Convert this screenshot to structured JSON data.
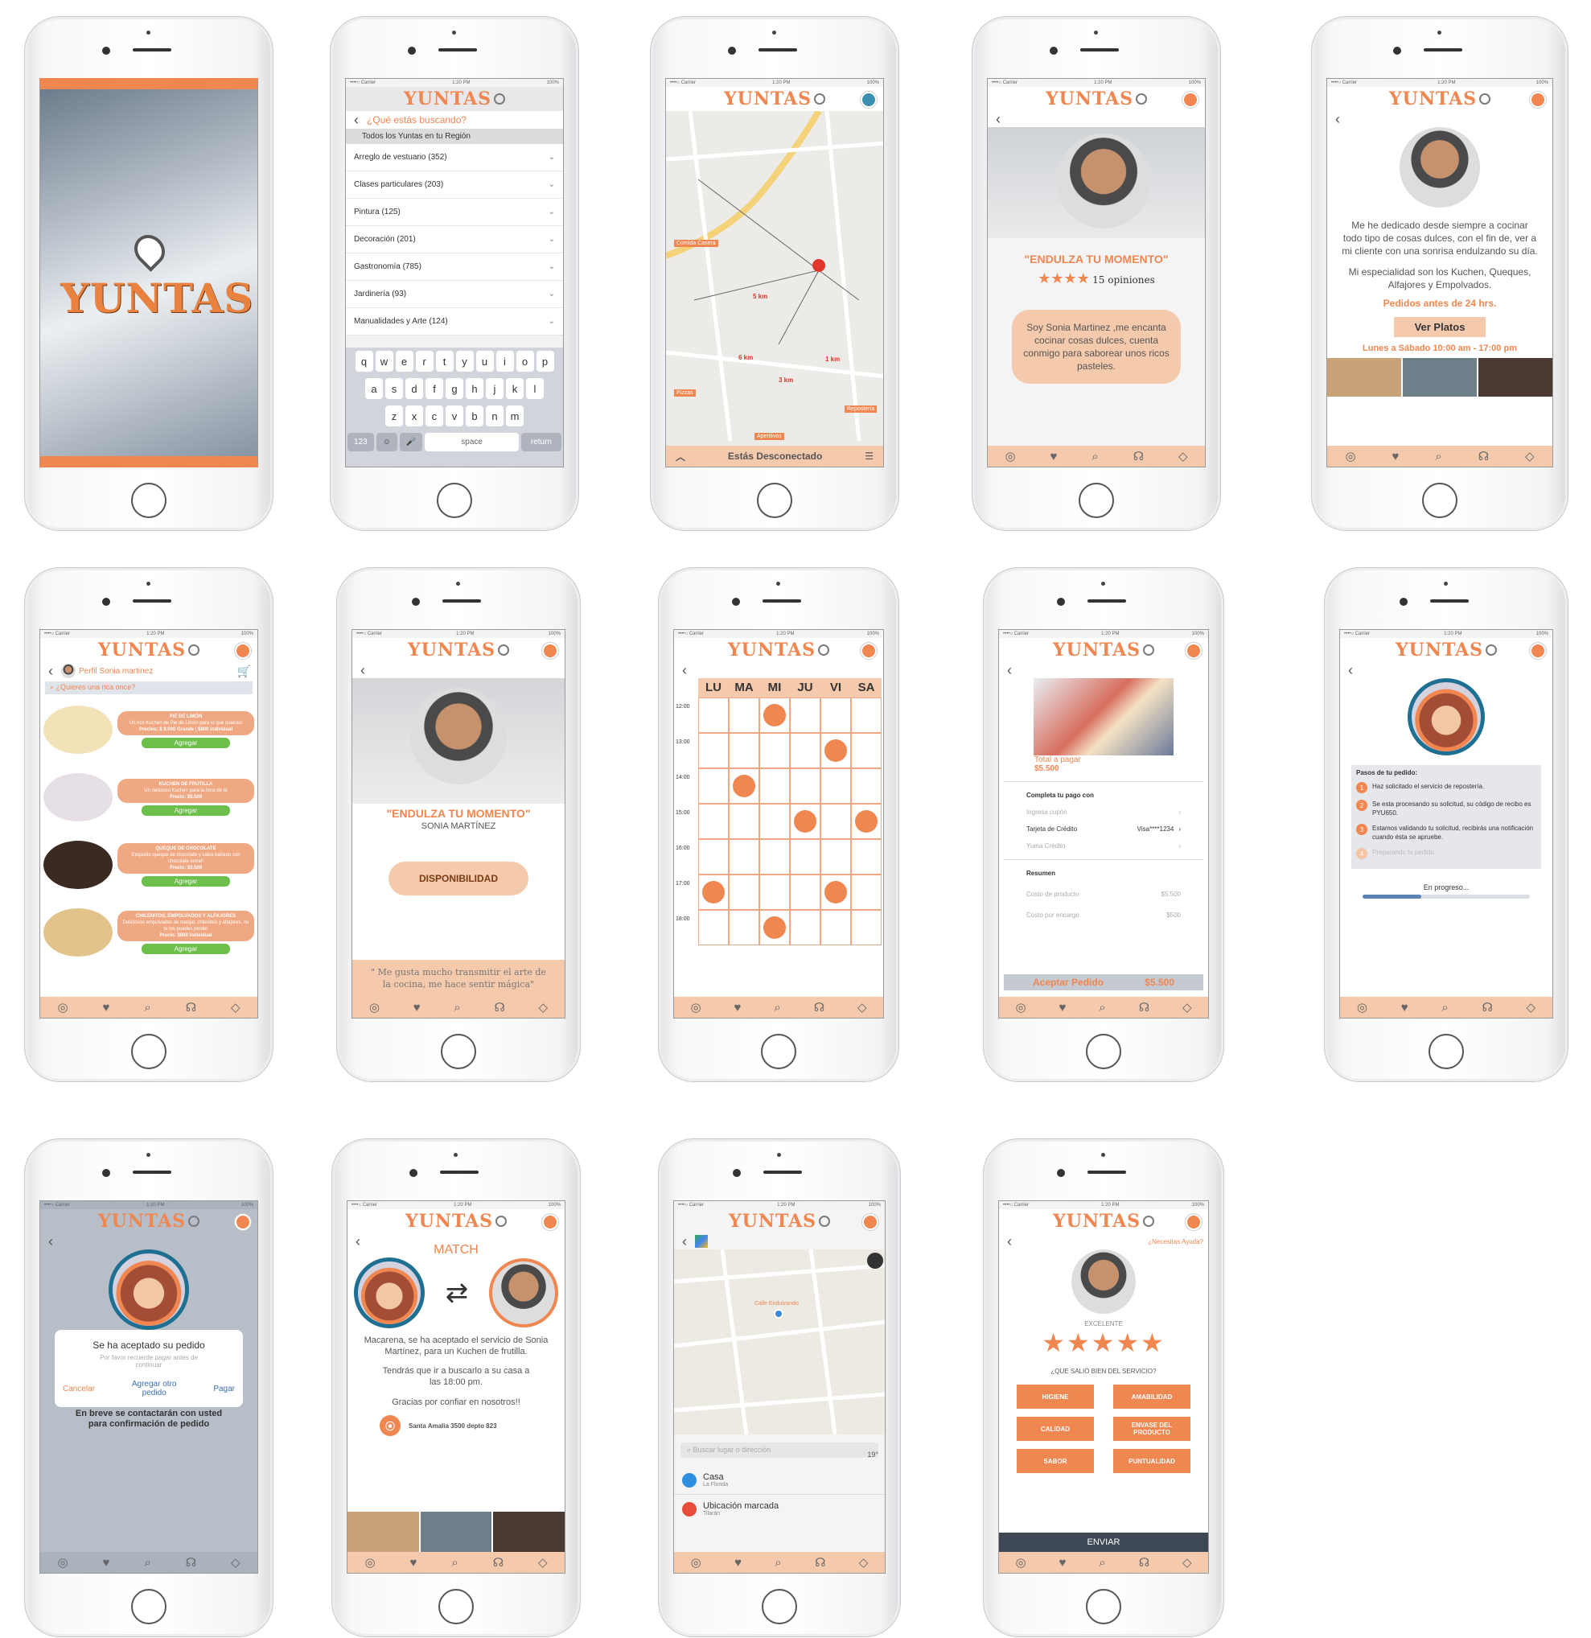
{
  "brand": {
    "name": "YUNTAS"
  },
  "status": {
    "carrier": "••••○ Carrier",
    "time": "1:20 PM",
    "battery": "100%"
  },
  "p1": {
    "logo": "YUNTAS"
  },
  "p2": {
    "prompt": "¿Qué estás buscando?",
    "region": "Todos los Yuntas en tu Región",
    "items": [
      "Arreglo de vestuario (352)",
      "Clases particulares (203)",
      "Pintura (125)",
      "Decoración (201)",
      "Gastronomía (785)",
      "Jardinería (93)",
      "Manualidades y Arte (124)"
    ],
    "keys": {
      "row1": [
        "q",
        "w",
        "e",
        "r",
        "t",
        "y",
        "u",
        "i",
        "o",
        "p"
      ],
      "row2": [
        "a",
        "s",
        "d",
        "f",
        "g",
        "h",
        "j",
        "k",
        "l"
      ],
      "row3": [
        "z",
        "x",
        "c",
        "v",
        "b",
        "n",
        "m"
      ],
      "k123": "123",
      "space": "space",
      "ret": "return"
    }
  },
  "p3": {
    "labels": [
      "Comida Casera",
      "Pizzas",
      "Aperitivos",
      "Repostería"
    ],
    "distances": [
      "5 km",
      "6 km",
      "3 km",
      "1 km"
    ],
    "footer": "Estás Desconectado"
  },
  "p4": {
    "title": "\"ENDULZA TU MOMENTO\"",
    "reviews": "15 opiniones",
    "stars": "★★★★",
    "bio": "Soy Sonia Martinez ,me encanta cocinar cosas dulces, cuenta conmigo para saborear unos ricos pasteles."
  },
  "p5": {
    "text1": "Me he dedicado desde siempre a cocinar todo tipo de cosas dulces, con el fin de, ver a mi cliente con una sonrisa endulzando su día.",
    "text2": "Mi especialidad son los Kuchen, Queques, Alfajores y Empolvados.",
    "orders": "Pedidos antes de 24 hrs.",
    "button": "Ver Platos",
    "hours": "Lunes a Sábado 10:00 am - 17:00 pm"
  },
  "p6": {
    "profile": "Perfil Sonia martinez",
    "search": "¿Quieres una rica once?",
    "products": [
      {
        "name": "PIE DE LIMÓN",
        "desc": "Un rico Kuchen de Pie de Limón para lo que quieras!",
        "price": "Precios: $ 9.000 Grande | $800 individual",
        "add": "Agregar"
      },
      {
        "name": "KUCHEN DE FRUTILLA",
        "desc": "Un delicioso Kuchen para la hora de té",
        "price": "Precio: $5.500",
        "add": "Agregar"
      },
      {
        "name": "QUEQUE DE CHOCOLATE",
        "desc": "Exquisito queque de chocolate y salsa bañado con chocolate extra!!",
        "price": "Precio: $3.500",
        "add": "Agregar"
      },
      {
        "name": "CHILENITOS, EMPOLVADOS Y ALFAJORES",
        "desc": "Deliciosos empolvados de manjar, chilenitos y alfajores, no te los puedes perder",
        "price": "Precio: $800 individual",
        "add": "Agregar"
      }
    ]
  },
  "p7": {
    "title": "\"ENDULZA TU MOMENTO\"",
    "name": "SONIA MARTÍNEZ",
    "button": "DISPONIBILIDAD",
    "quote": "\" Me gusta mucho transmitir el arte de la cocina, me hace sentir mágica\""
  },
  "p8": {
    "days": [
      "LU",
      "MA",
      "MI",
      "JU",
      "VI",
      "SA"
    ],
    "hours": [
      "12:00",
      "13:00",
      "14:00",
      "15:00",
      "16:00",
      "17:00",
      "18:00"
    ],
    "slots": [
      [
        0,
        2
      ],
      [
        1,
        4
      ],
      [
        2,
        1
      ],
      [
        3,
        3
      ],
      [
        3,
        5
      ],
      [
        5,
        0
      ],
      [
        5,
        4
      ],
      [
        6,
        2
      ]
    ]
  },
  "p9": {
    "total_label": "Total a pagar",
    "total": "$5.500",
    "complete": "Completa tu pago con",
    "opt1": "Ingresa cupón",
    "opt2": "Tarjeta de Crédito",
    "opt2val": "Visa****1234",
    "opt3": "Yuma Crédito",
    "summary": "Resumen",
    "row1": "Costo de producto",
    "row1v": "$5.500",
    "row2": "Costo por encargo",
    "row2v": "$500",
    "accept": "Aceptar Pedido",
    "accept_val": "$5.500"
  },
  "p10": {
    "title": "Pasos de tu pedido:",
    "steps": [
      "Haz solicitado el servicio de repostería.",
      "Se esta procesando su solicitud, su código de recibo es PYU650.",
      "Estamos validando tu solicitud, recibirás una notificación cuando ésta se apruebe.",
      "Preparando tu pedido."
    ],
    "progress_label": "En progreso...",
    "progress": 0.35
  },
  "p11": {
    "title": "Se ha aceptado su pedido",
    "sub": "Por favor recuerde pagar antes de continuar",
    "cancel": "Cancelar",
    "other": "Agregar otro pedido",
    "pay": "Pagar",
    "below": "En breve se contactarán con usted para confirmación de pedido"
  },
  "p12": {
    "match": "MATCH",
    "text1": "Macarena, se ha aceptado el servicio de Sonia Martínez, para un Kuchen de frutilla.",
    "text2": "Tendrás que ir a buscarlo a su casa a las 18:00 pm.",
    "text3": "Gracias por confiar en nosotros!!",
    "address": "Santa Amalia 3500 depto 823"
  },
  "p13": {
    "search": "Buscar lugar o dirección",
    "place1": "Casa",
    "place1sub": "La Florida",
    "place2": "Ubicación marcada",
    "place2sub": "Tilarán",
    "temp": "19°",
    "poi": "Calle Endulzando"
  },
  "p14": {
    "help": "¿Necesitas Ayuda?",
    "rating": "EXCELENTE",
    "stars": "★★★★★",
    "question": "¿QUE SALIÓ BIEN DEL SERVICIO?",
    "tags": [
      "HIGIENE",
      "AMABILIDAD",
      "CALIDAD",
      "ENVASE DEL PRODUCTO",
      "SABOR",
      "PUNTUALIDAD"
    ],
    "send": "ENVIAR"
  },
  "colors": {
    "accent": "#f08650",
    "peach": "#f5c9ac",
    "navy": "#1f6f93"
  }
}
